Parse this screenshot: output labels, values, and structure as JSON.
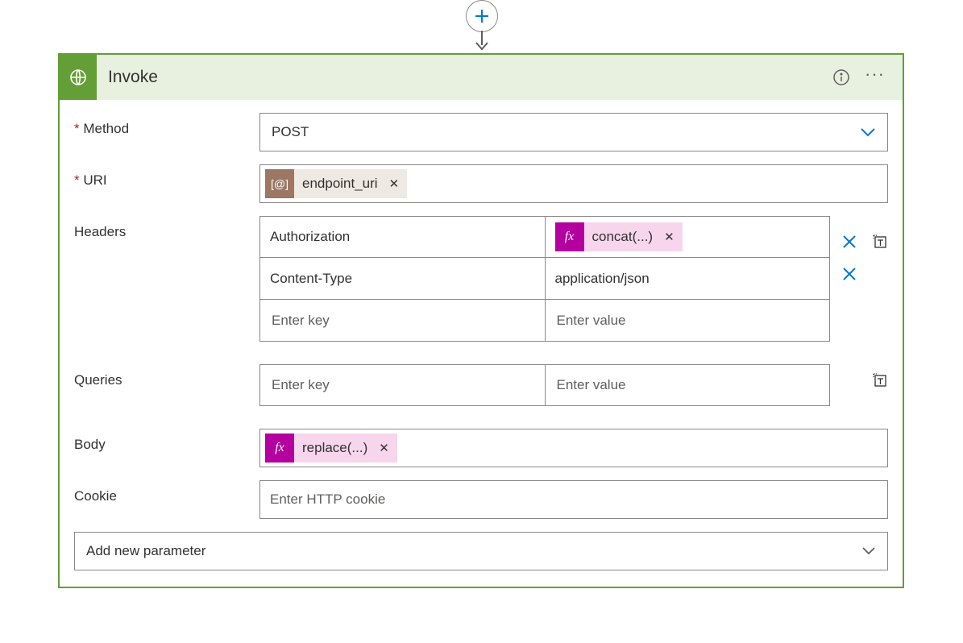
{
  "card": {
    "title": "Invoke"
  },
  "form": {
    "method": {
      "label": "Method",
      "value": "POST"
    },
    "uri": {
      "label": "URI",
      "token": {
        "kind": "param",
        "badge": "[@]",
        "label": "endpoint_uri"
      }
    },
    "headers": {
      "label": "Headers",
      "key_placeholder": "Enter key",
      "value_placeholder": "Enter value",
      "rows": [
        {
          "key": "Authorization",
          "value_token": {
            "kind": "fx",
            "badge": "fx",
            "label": "concat(...)"
          }
        },
        {
          "key": "Content-Type",
          "value": "application/json"
        }
      ]
    },
    "queries": {
      "label": "Queries",
      "key_placeholder": "Enter key",
      "value_placeholder": "Enter value"
    },
    "body": {
      "label": "Body",
      "token": {
        "kind": "fx",
        "badge": "fx",
        "label": "replace(...)"
      }
    },
    "cookie": {
      "label": "Cookie",
      "placeholder": "Enter HTTP cookie"
    },
    "add_param": "Add new parameter"
  }
}
